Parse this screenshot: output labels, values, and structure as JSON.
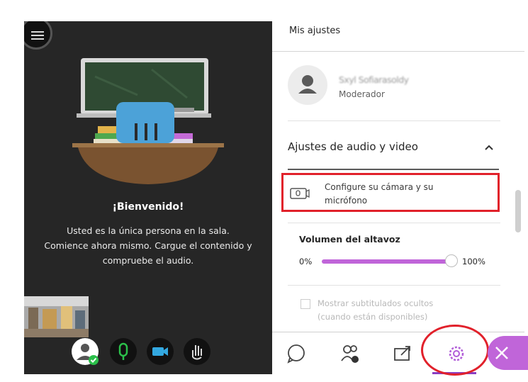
{
  "stage": {
    "welcome_title": "¡Bienvenido!",
    "welcome_lines": [
      "Usted es la única persona en la sala.",
      "Comience ahora mismo. Cargue el contenido y",
      "compruebe el audio."
    ]
  },
  "panel": {
    "title": "Mis ajustes",
    "user": {
      "name": "Sxyl Sofiarasoldy",
      "role": "Moderador"
    },
    "section_title": "Ajustes de audio y video",
    "config_lines": [
      "Configure su cámara y su",
      "micrófono"
    ],
    "volume": {
      "label": "Volumen del altavoz",
      "min": "0%",
      "max": "100%",
      "value": 1.0
    },
    "captions_lines": [
      "Mostrar subtitulados ocultos",
      "(cuando están disponibles)"
    ]
  },
  "colors": {
    "accent": "#c065d9",
    "highlight": "#e1212b",
    "mic_green": "#2bbf4a",
    "cam_blue": "#33a8e0"
  }
}
